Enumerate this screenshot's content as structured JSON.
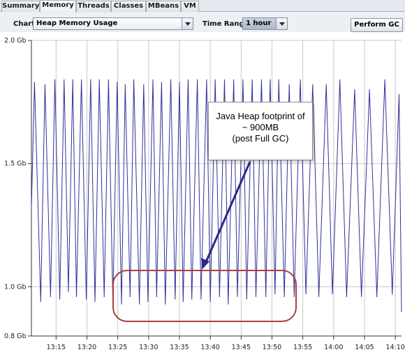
{
  "tabs": [
    {
      "label": "Summary",
      "active": false
    },
    {
      "label": "Memory",
      "active": true
    },
    {
      "label": "Threads",
      "active": false
    },
    {
      "label": "Classes",
      "active": false
    },
    {
      "label": "MBeans",
      "active": false
    },
    {
      "label": "VM",
      "active": false
    }
  ],
  "toolbar": {
    "chart_label": "Chart:",
    "chart_value": "Heap Memory Usage",
    "time_range_label": "Time Range:",
    "time_range_value": "1 hour",
    "perform_gc_label": "Perform GC"
  },
  "annotation": {
    "lines": [
      "Java Heap footprint of",
      "~ 900MB",
      "(post Full GC)"
    ],
    "arrow_color": "#2a2a8a",
    "highlight_color": "#a8423c"
  },
  "colors": {
    "series_line": "#2f2f9a",
    "grid": "#c8c8c8",
    "axis": "#333333"
  },
  "chart_data": {
    "type": "line",
    "title": "",
    "xlabel": "",
    "ylabel": "",
    "y_ticks": [
      "0.8 Gb",
      "1.0 Gb",
      "1.5 Gb",
      "2.0 Gb"
    ],
    "y_tick_values": [
      0.8,
      1.0,
      1.5,
      2.0
    ],
    "ylim": [
      0.8,
      2.0
    ],
    "x_ticks": [
      "13:15",
      "13:20",
      "13:25",
      "13:30",
      "13:35",
      "13:40",
      "13:45",
      "13:50",
      "13:55",
      "14:00",
      "14:05",
      "14:10"
    ],
    "x_tick_values": [
      795,
      800,
      805,
      810,
      815,
      820,
      825,
      830,
      835,
      840,
      845,
      850
    ],
    "xlim": [
      791,
      851
    ],
    "grid": true,
    "series": [
      {
        "color": "#2f2f9a",
        "x": [
          791,
          791.5,
          792.5,
          793.2,
          794.1,
          794.8,
          795.6,
          796.3,
          797.0,
          797.7,
          798.3,
          799.1,
          799.9,
          800.6,
          801.3,
          802.0,
          802.8,
          803.5,
          804.2,
          804.9,
          805.6,
          806.2,
          807.0,
          807.6,
          808.5,
          809.2,
          809.9,
          810.7,
          811.3,
          812.1,
          812.7,
          813.6,
          814.3,
          815.0,
          815.6,
          816.4,
          817.0,
          817.9,
          818.5,
          819.4,
          820.0,
          820.8,
          821.5,
          822.3,
          822.9,
          823.8,
          824.4,
          825.3,
          825.9,
          826.8,
          827.4,
          828.3,
          829.0,
          829.7,
          830.5,
          831.1,
          832.0,
          832.8,
          833.6,
          834.6,
          835.5,
          836.6,
          837.6,
          838.8,
          839.8,
          841.0,
          842.1,
          843.4,
          844.5,
          845.8,
          847.0,
          848.3,
          849.5,
          850.6,
          851.0
        ],
        "y": [
          1.32,
          1.83,
          0.94,
          1.82,
          0.96,
          1.84,
          0.95,
          1.84,
          0.98,
          1.84,
          0.96,
          1.84,
          0.95,
          1.84,
          0.94,
          1.84,
          0.96,
          1.84,
          0.94,
          1.83,
          0.93,
          1.82,
          0.96,
          1.84,
          0.93,
          1.82,
          0.94,
          1.84,
          0.96,
          1.83,
          0.93,
          1.84,
          0.95,
          1.83,
          0.94,
          1.84,
          0.95,
          1.84,
          0.95,
          1.84,
          0.94,
          1.84,
          0.96,
          1.84,
          0.93,
          1.84,
          0.96,
          1.84,
          0.95,
          1.84,
          0.96,
          1.84,
          0.96,
          1.84,
          0.97,
          1.84,
          0.96,
          1.82,
          0.96,
          1.84,
          0.97,
          1.82,
          0.96,
          1.82,
          0.97,
          1.84,
          0.96,
          1.8,
          0.96,
          1.8,
          0.96,
          1.84,
          0.97,
          1.78,
          0.9
        ]
      }
    ]
  }
}
